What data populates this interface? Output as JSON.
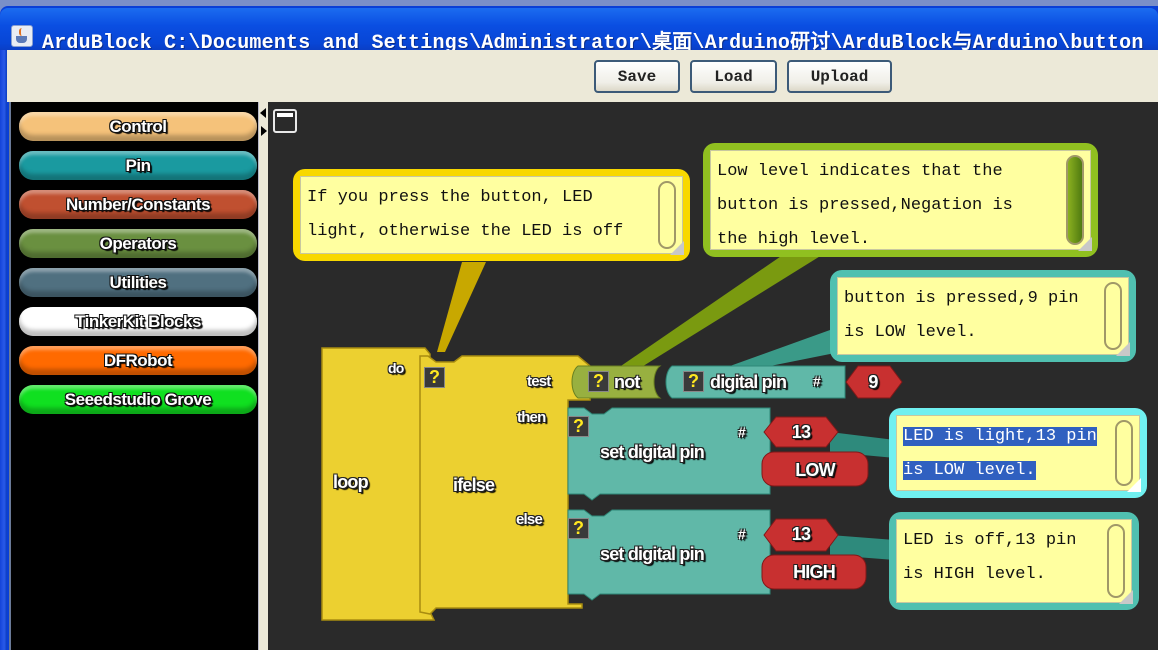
{
  "window": {
    "title": "ArduBlock C:\\Documents and Settings\\Administrator\\桌面\\Arduino研讨\\ArduBlock与Arduino\\button"
  },
  "toolbar": {
    "save_label": "Save",
    "load_label": "Load",
    "upload_label": "Upload"
  },
  "palette": {
    "categories": [
      {
        "label": "Control",
        "color": "#f5c27a"
      },
      {
        "label": "Pin",
        "color": "#1a9aa0"
      },
      {
        "label": "Number/Constants",
        "color": "#c05030"
      },
      {
        "label": "Operators",
        "color": "#6a9040"
      },
      {
        "label": "Utilities",
        "color": "#507080"
      },
      {
        "label": "TinkerKit Blocks",
        "color": "#ffffff"
      },
      {
        "label": "DFRobot",
        "color": "#ff6a00"
      },
      {
        "label": "Seeedstudio Grove",
        "color": "#10e020"
      }
    ]
  },
  "blocks": {
    "loop": {
      "label": "loop",
      "do_label": "do",
      "color": "#ecd030"
    },
    "ifelse": {
      "label": "ifelse",
      "test_label": "test",
      "then_label": "then",
      "else_label": "else",
      "color": "#ecd030"
    },
    "not": {
      "label": "not",
      "color": "#98b040"
    },
    "digital_pin": {
      "label": "digital pin",
      "hash": "#",
      "pin": "9",
      "color": "#60b8a8"
    },
    "set_pin_then": {
      "label": "set digital pin",
      "hash": "#",
      "pin": "13",
      "value": "LOW",
      "color": "#60b8a8"
    },
    "set_pin_else": {
      "label": "set digital pin",
      "hash": "#",
      "pin": "13",
      "value": "HIGH",
      "color": "#60b8a8"
    },
    "value_color": "#c83030",
    "help_glyph": "?"
  },
  "comments": {
    "ifelse_comment": "If you press the button, LED\nlight, otherwise the LED is off",
    "not_comment": "Low level indicates that the\nbutton is pressed,Negation is\nthe high level.",
    "digital_pin_comment": "button is pressed,9 pin\nis LOW level.",
    "then_comment_line1": "LED is light,13 pin",
    "then_comment_line2": "is LOW level.",
    "else_comment": "LED is off,13 pin\nis HIGH level."
  }
}
